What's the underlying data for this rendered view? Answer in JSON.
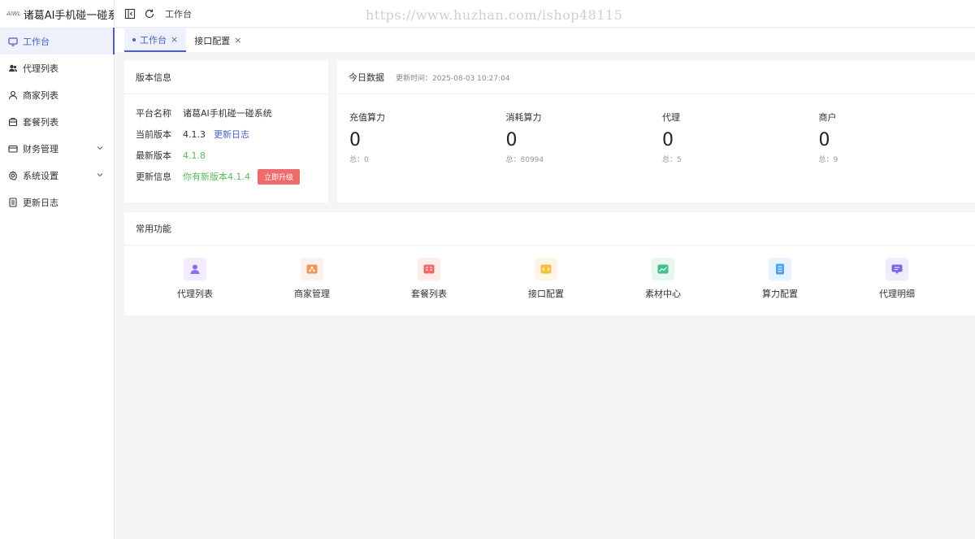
{
  "brand": {
    "logo_text": "AIWL",
    "title": "诸葛AI手机碰一碰系"
  },
  "sidebar": {
    "items": [
      {
        "label": "工作台",
        "icon": "monitor-icon"
      },
      {
        "label": "代理列表",
        "icon": "users-icon"
      },
      {
        "label": "商家列表",
        "icon": "user-icon"
      },
      {
        "label": "套餐列表",
        "icon": "package-icon"
      },
      {
        "label": "财务管理",
        "icon": "wallet-icon"
      },
      {
        "label": "系统设置",
        "icon": "gear-icon"
      },
      {
        "label": "更新日志",
        "icon": "log-icon"
      }
    ]
  },
  "topbar": {
    "breadcrumb": "工作台"
  },
  "watermark": "https://www.huzhan.com/ishop48115",
  "tabs": [
    {
      "label": "工作台",
      "close": "×"
    },
    {
      "label": "接口配置",
      "close": "×"
    }
  ],
  "version_card": {
    "title": "版本信息",
    "rows": {
      "platform": {
        "key": "平台名称",
        "value": "诸葛AI手机碰一碰系统"
      },
      "current": {
        "key": "当前版本",
        "value": "4.1.3",
        "link": "更新日志"
      },
      "latest": {
        "key": "最新版本",
        "value": "4.1.8"
      },
      "update": {
        "key": "更新信息",
        "value": "你有新版本4.1.4",
        "button": "立即升级"
      }
    }
  },
  "today_card": {
    "title": "今日数据",
    "updated": "更新时间：2025-08-03 10:27:04",
    "stats": [
      {
        "label": "充值算力",
        "value": "0",
        "total": "总：0"
      },
      {
        "label": "消耗算力",
        "value": "0",
        "total": "总：80994"
      },
      {
        "label": "代理",
        "value": "0",
        "total": "总：5"
      },
      {
        "label": "商户",
        "value": "0",
        "total": "总：9"
      }
    ]
  },
  "common_card": {
    "title": "常用功能",
    "items": [
      {
        "label": "代理列表",
        "bg": "#f1edfd",
        "fg": "#8b6cf0"
      },
      {
        "label": "商家管理",
        "bg": "#fdf1ea",
        "fg": "#f2935a"
      },
      {
        "label": "套餐列表",
        "bg": "#fdecec",
        "fg": "#ee6b6b"
      },
      {
        "label": "接口配置",
        "bg": "#fdf6e6",
        "fg": "#f5bf3d"
      },
      {
        "label": "素材中心",
        "bg": "#e9f7f1",
        "fg": "#3fbf8a"
      },
      {
        "label": "算力配置",
        "bg": "#e8f3fd",
        "fg": "#4aa3ee"
      },
      {
        "label": "代理明细",
        "bg": "#efedfd",
        "fg": "#7b66ee"
      }
    ]
  },
  "colors": {
    "accent": "#4a5fc1",
    "upgrade": "#f06b6b",
    "success": "#5cb85c"
  }
}
